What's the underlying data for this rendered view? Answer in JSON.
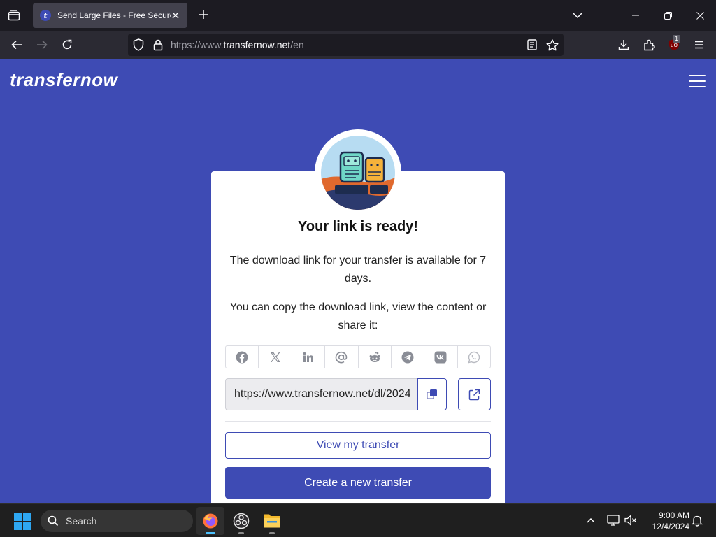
{
  "browser": {
    "tab": {
      "title": "Send Large Files - Free Secure F",
      "favicon_letter": "t"
    },
    "url": {
      "prefix": "https://www.",
      "domain": "transfernow.net",
      "path": "/en"
    },
    "extension_badge": "1"
  },
  "page": {
    "logo": "transfernow",
    "card": {
      "title": "Your link is ready!",
      "text1": "The download link for your transfer is available for 7 days.",
      "text2": "You can copy the download link, view the content or share it:",
      "share_icons": [
        "facebook-icon",
        "x-icon",
        "linkedin-icon",
        "email-icon",
        "reddit-icon",
        "telegram-icon",
        "vk-icon",
        "whatsapp-icon"
      ],
      "link_value": "https://www.transfernow.net/dl/2024",
      "view_button": "View my transfer",
      "create_button": "Create a new transfer"
    },
    "colors": {
      "brand": "#3e4bb4",
      "card": "#ffffff"
    }
  },
  "taskbar": {
    "search_label": "Search",
    "time": "9:00 AM",
    "date": "12/4/2024"
  }
}
